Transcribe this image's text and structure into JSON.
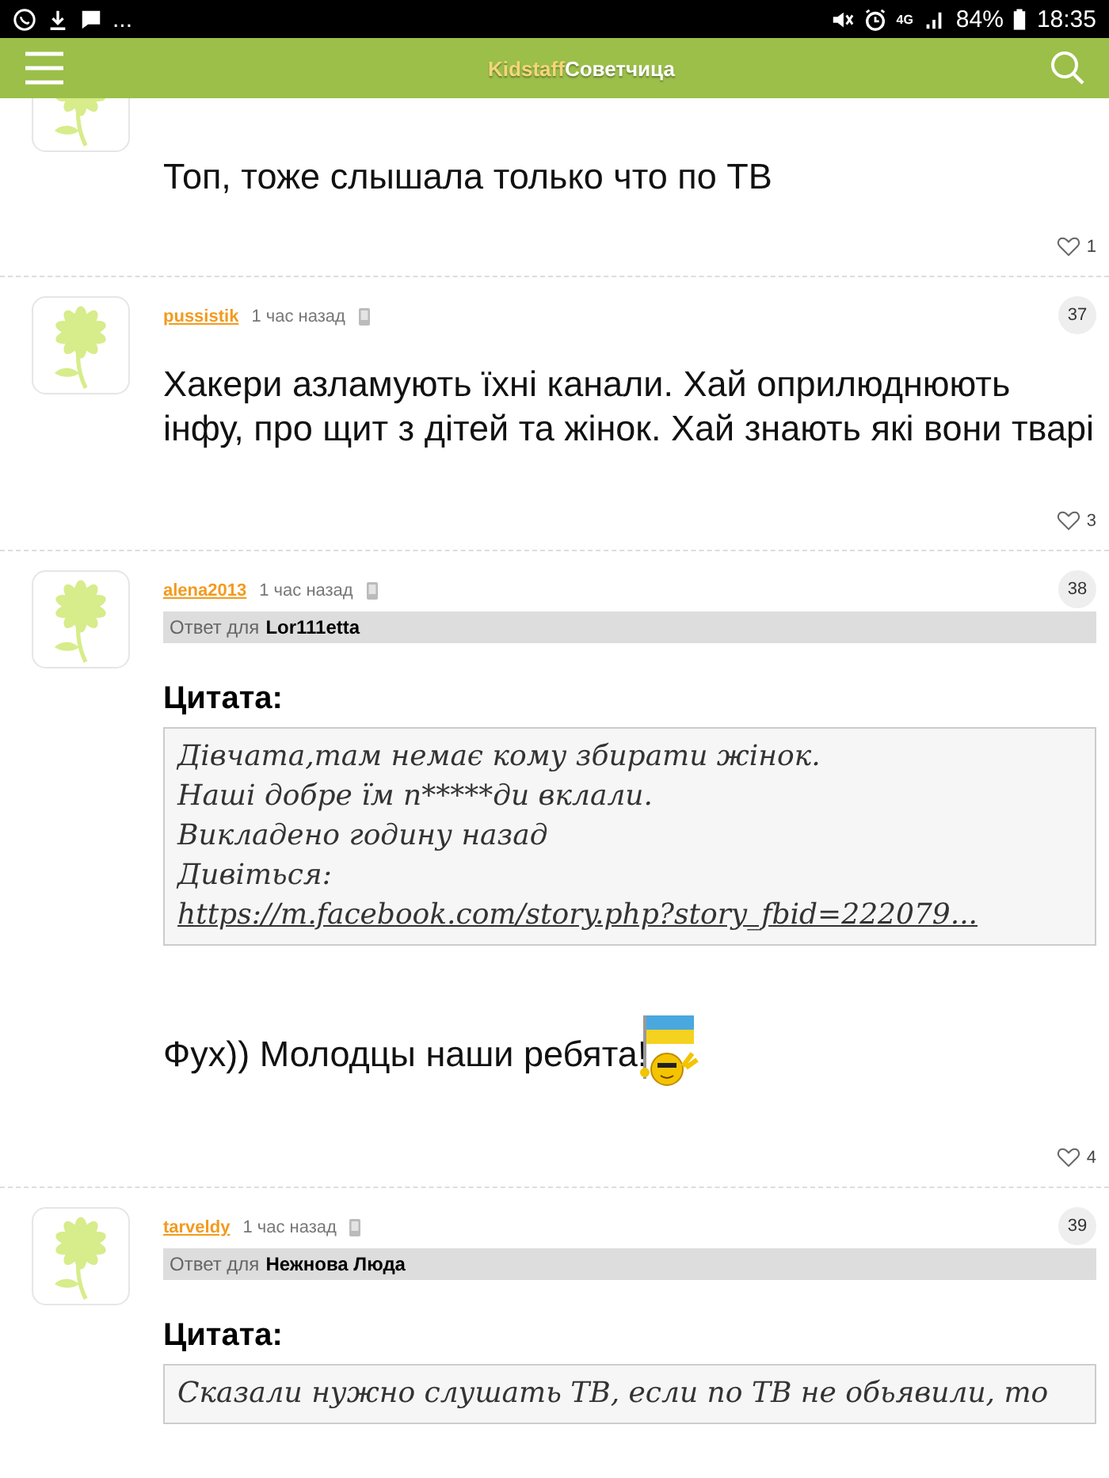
{
  "status_bar": {
    "time": "18:35",
    "battery": "84%",
    "network": "4G",
    "notifications": "..."
  },
  "app_bar": {
    "title_brand": "Kidstaff",
    "title_section": "Советчица"
  },
  "posts": [
    {
      "partial": true,
      "text": "Топ, тоже слышала только что по ТВ",
      "likes": "1"
    },
    {
      "author": "pussistik",
      "time": "1 час назад",
      "number": "37",
      "text": "Хакери азламують їхні канали. Хай оприлюднюють інфу, про щит з дітей та жінок. Хай знають які вони тварі",
      "likes": "3"
    },
    {
      "author": "alena2013",
      "time": "1 час назад",
      "number": "38",
      "reply_label": "Ответ для",
      "reply_to": "Lor111etta",
      "quote_title": "Цитата:",
      "quote_lines": [
        "Дівчата,там немає кому збирати жінок.",
        "Наші добре їм п*****ди вклали.",
        "Викладено годину назад"
      ],
      "quote_link_prefix": "Дивіться:",
      "quote_link": "https://m.facebook.com/story.php?story_fbid=222079...",
      "text": "Фух)) Молодцы наши ребята!",
      "emoticon": true,
      "likes": "4"
    },
    {
      "author": "tarveldy",
      "time": "1 час назад",
      "number": "39",
      "reply_label": "Ответ для",
      "reply_to": "Нежнова Люда",
      "quote_title": "Цитата:",
      "quote_lines": [
        "Сказали нужно слушать ТВ, если по ТВ не обьявили, то"
      ]
    }
  ]
}
